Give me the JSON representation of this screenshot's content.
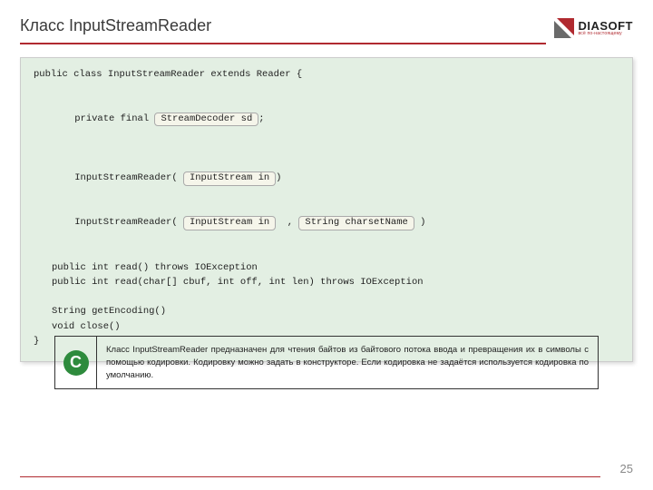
{
  "title": "Класс InputStreamReader",
  "logo": {
    "main": "DIASOFT",
    "sub": "всё по-настоящему"
  },
  "code": {
    "l1": "public class InputStreamReader extends Reader {",
    "l2_pre": "private final ",
    "l2_pill": "StreamDecoder sd",
    "l2_post": ";",
    "l3_pre": "InputStreamReader( ",
    "l3_pill": "InputStream in",
    "l3_post": ")",
    "l4_pre": "InputStreamReader( ",
    "l4_pill1": "InputStream in",
    "l4_mid": "  , ",
    "l4_pill2": "String charsetName",
    "l4_post": " )",
    "l5": "public int read() throws IOException",
    "l6": "public int read(char[] cbuf, int off, int len) throws IOException",
    "l7": "String getEncoding()",
    "l8": "void close()",
    "l9": "}"
  },
  "info": {
    "badge": "С",
    "text": "Класс InputStreamReader предназначен для чтения байтов из байтового потока ввода и превращения их в символы с помощью кодировки. Кодировку можно задать в конструкторе. Если кодировка не задаётся используется кодировка по умолчанию."
  },
  "page": "25"
}
